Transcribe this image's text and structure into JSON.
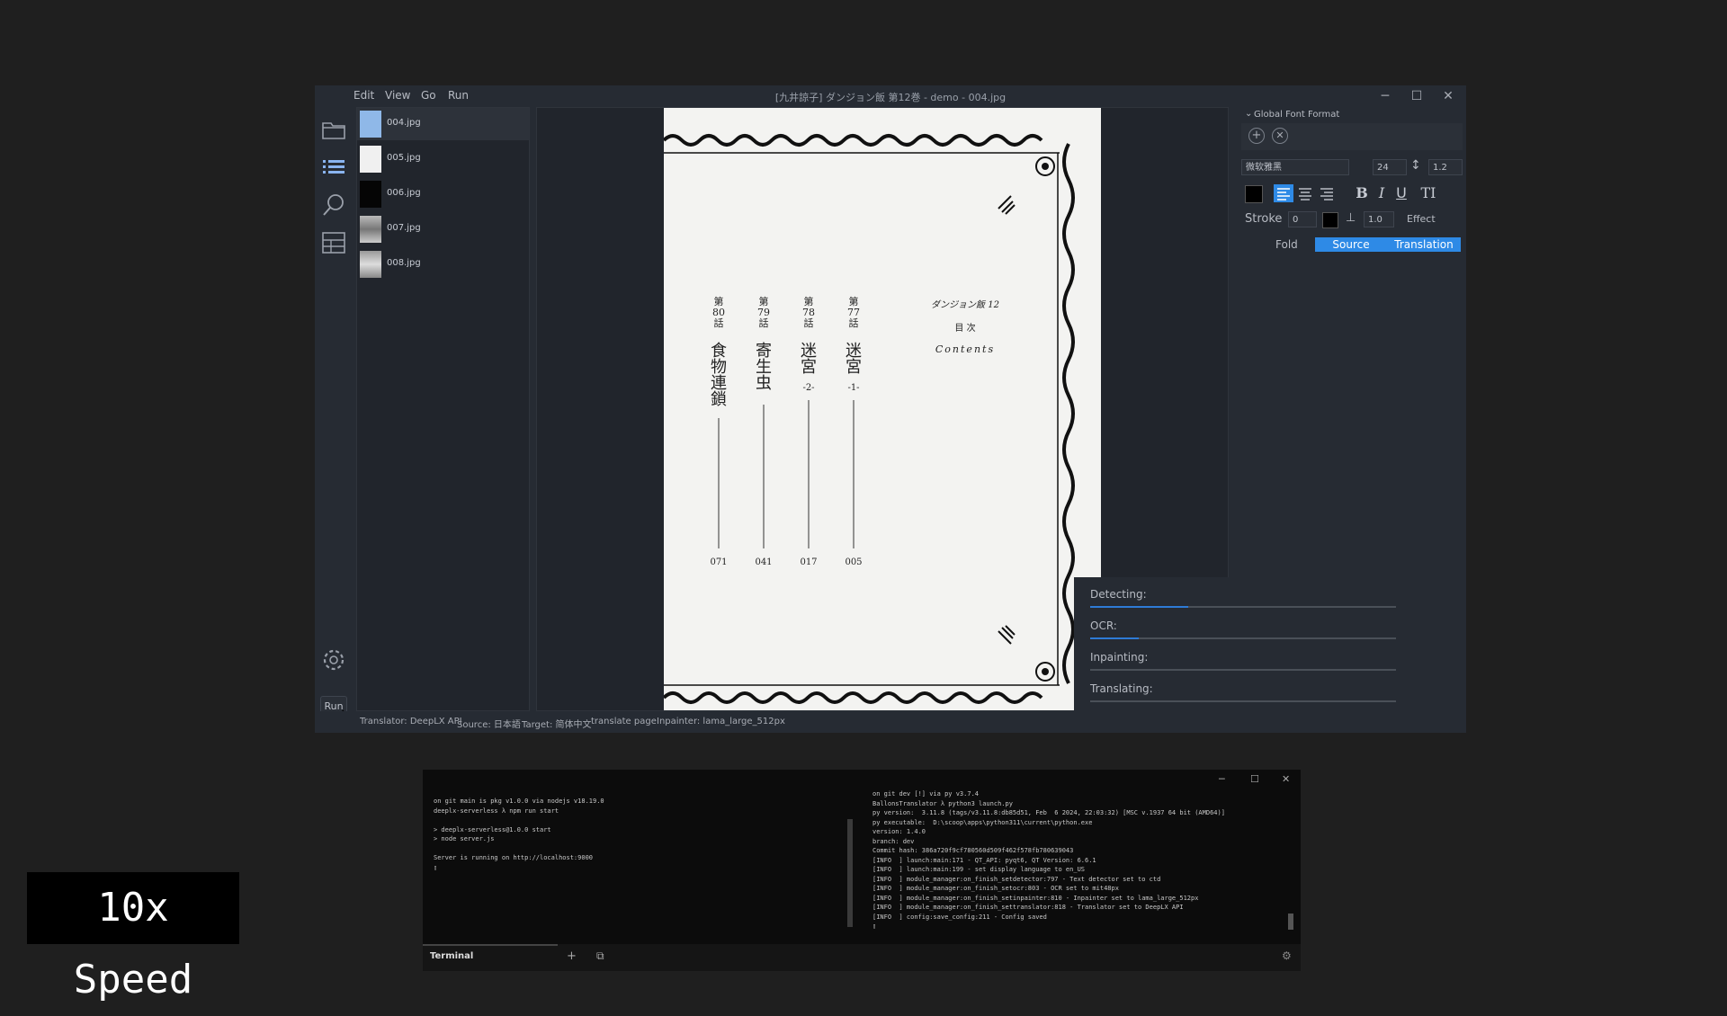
{
  "window": {
    "title": "[九井諒子] ダンジョン飯 第12巻 - demo - 004.jpg",
    "menu": [
      "Edit",
      "View",
      "Go",
      "Run"
    ],
    "controls": {
      "minimize": "─",
      "maximize": "☐",
      "close": "✕"
    }
  },
  "leftbar": {
    "run_label": "Run"
  },
  "files": [
    {
      "name": "004.jpg",
      "selected": true
    },
    {
      "name": "005.jpg"
    },
    {
      "name": "006.jpg"
    },
    {
      "name": "007.jpg"
    },
    {
      "name": "008.jpg"
    }
  ],
  "page": {
    "chapters": [
      {
        "num": "第\n80\n話",
        "title": "食物連鎖",
        "page": "071"
      },
      {
        "num": "第\n79\n話",
        "title": "寄生虫",
        "page": "041"
      },
      {
        "num": "第\n78\n話",
        "title": "迷宮",
        "sub": "-2-",
        "page": "017"
      },
      {
        "num": "第\n77\n話",
        "title": "迷宮",
        "sub": "-1-",
        "page": "005"
      }
    ],
    "book_title": "ダンジョン飯 12",
    "toc_label": "目 次",
    "contents_label": "Contents"
  },
  "font_panel": {
    "header": "Global Font Format",
    "font_name": "微软雅黑",
    "font_size": "24",
    "line_spacing": "1.2",
    "stroke_label": "Stroke",
    "stroke_value": "0",
    "letter_spacing": "1.0",
    "effect_label": "Effect",
    "tabs": {
      "fold": "Fold",
      "source": "Source",
      "translation": "Translation"
    },
    "accent_color": "#2e8ae6"
  },
  "progress": {
    "detecting": "Detecting:",
    "ocr": "OCR:",
    "inpainting": "Inpainting:",
    "translating": "Translating:",
    "detecting_level": 0.32,
    "ocr_level": 0.16,
    "inpainting_level": 0.0,
    "translating_level": 0.0
  },
  "statusbar": {
    "translator": "Translator: DeepLX API",
    "source": "Source: 日本語",
    "target": "Target: 简体中文",
    "mode": "translate page",
    "inpainter": "Inpainter: lama_large_512px"
  },
  "terminal": {
    "tab_label": "Terminal",
    "left_text": "on git main is pkg v1.0.0 via nodejs v18.19.0\ndeeplx-serverless λ npm run start\n\n> deeplx-serverless@1.0.0 start\n> node server.js\n\nServer is running on http://localhost:9000\n▯",
    "right_text": "on git dev [!] via py v3.7.4\nBallonsTranslator λ python3 launch.py\npy version:  3.11.8 (tags/v3.11.8:db85d51, Feb  6 2024, 22:03:32) [MSC v.1937 64 bit (AMD64)]\npy executable:  D:\\scoop\\apps\\python311\\current\\python.exe\nversion: 1.4.0\nbranch: dev\nCommit hash: 386a720f9cf780560d509f462f578fb780639043\n[INFO  ] launch:main:171 - QT_API: pyqt6, QT Version: 6.6.1\n[INFO  ] launch:main:199 - set display language to en_US\n[INFO  ] module_manager:on_finish_setdetector:797 - Text detector set to ctd\n[INFO  ] module_manager:on_finish_setocr:803 - OCR set to mit48px\n[INFO  ] module_manager:on_finish_setinpainter:810 - Inpainter set to lama_large_512px\n[INFO  ] module_manager:on_finish_settranslator:818 - Translator set to DeepLX API\n[INFO  ] config:save_config:211 - Config saved\n▯"
  },
  "overlay": {
    "speed_label": "10x Speed"
  }
}
